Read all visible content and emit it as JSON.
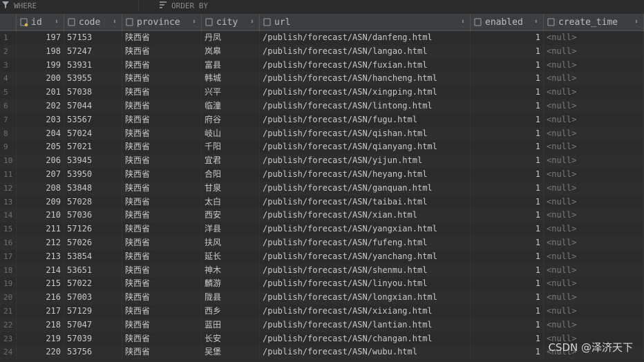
{
  "filter": {
    "where_label": "WHERE",
    "orderby_label": "ORDER BY"
  },
  "columns": [
    {
      "key": "id",
      "label": "id"
    },
    {
      "key": "code",
      "label": "code"
    },
    {
      "key": "province",
      "label": "province"
    },
    {
      "key": "city",
      "label": "city"
    },
    {
      "key": "url",
      "label": "url"
    },
    {
      "key": "enabled",
      "label": "enabled"
    },
    {
      "key": "create_time",
      "label": "create_time"
    }
  ],
  "rows": [
    [
      "1",
      "197",
      "57153",
      "陕西省",
      "丹凤",
      "/publish/forecast/ASN/danfeng.html",
      "1",
      "<null>"
    ],
    [
      "2",
      "198",
      "57247",
      "陕西省",
      "岚皋",
      "/publish/forecast/ASN/langao.html",
      "1",
      "<null>"
    ],
    [
      "3",
      "199",
      "53931",
      "陕西省",
      "富县",
      "/publish/forecast/ASN/fuxian.html",
      "1",
      "<null>"
    ],
    [
      "4",
      "200",
      "53955",
      "陕西省",
      "韩城",
      "/publish/forecast/ASN/hancheng.html",
      "1",
      "<null>"
    ],
    [
      "5",
      "201",
      "57038",
      "陕西省",
      "兴平",
      "/publish/forecast/ASN/xingping.html",
      "1",
      "<null>"
    ],
    [
      "6",
      "202",
      "57044",
      "陕西省",
      "临潼",
      "/publish/forecast/ASN/lintong.html",
      "1",
      "<null>"
    ],
    [
      "7",
      "203",
      "53567",
      "陕西省",
      "府谷",
      "/publish/forecast/ASN/fugu.html",
      "1",
      "<null>"
    ],
    [
      "8",
      "204",
      "57024",
      "陕西省",
      "岐山",
      "/publish/forecast/ASN/qishan.html",
      "1",
      "<null>"
    ],
    [
      "9",
      "205",
      "57021",
      "陕西省",
      "千阳",
      "/publish/forecast/ASN/qianyang.html",
      "1",
      "<null>"
    ],
    [
      "10",
      "206",
      "53945",
      "陕西省",
      "宜君",
      "/publish/forecast/ASN/yijun.html",
      "1",
      "<null>"
    ],
    [
      "11",
      "207",
      "53950",
      "陕西省",
      "合阳",
      "/publish/forecast/ASN/heyang.html",
      "1",
      "<null>"
    ],
    [
      "12",
      "208",
      "53848",
      "陕西省",
      "甘泉",
      "/publish/forecast/ASN/ganquan.html",
      "1",
      "<null>"
    ],
    [
      "13",
      "209",
      "57028",
      "陕西省",
      "太白",
      "/publish/forecast/ASN/taibai.html",
      "1",
      "<null>"
    ],
    [
      "14",
      "210",
      "57036",
      "陕西省",
      "西安",
      "/publish/forecast/ASN/xian.html",
      "1",
      "<null>"
    ],
    [
      "15",
      "211",
      "57126",
      "陕西省",
      "洋县",
      "/publish/forecast/ASN/yangxian.html",
      "1",
      "<null>"
    ],
    [
      "16",
      "212",
      "57026",
      "陕西省",
      "扶风",
      "/publish/forecast/ASN/fufeng.html",
      "1",
      "<null>"
    ],
    [
      "17",
      "213",
      "53854",
      "陕西省",
      "延长",
      "/publish/forecast/ASN/yanchang.html",
      "1",
      "<null>"
    ],
    [
      "18",
      "214",
      "53651",
      "陕西省",
      "神木",
      "/publish/forecast/ASN/shenmu.html",
      "1",
      "<null>"
    ],
    [
      "19",
      "215",
      "57022",
      "陕西省",
      "麟游",
      "/publish/forecast/ASN/linyou.html",
      "1",
      "<null>"
    ],
    [
      "20",
      "216",
      "57003",
      "陕西省",
      "陇县",
      "/publish/forecast/ASN/longxian.html",
      "1",
      "<null>"
    ],
    [
      "21",
      "217",
      "57129",
      "陕西省",
      "西乡",
      "/publish/forecast/ASN/xixiang.html",
      "1",
      "<null>"
    ],
    [
      "22",
      "218",
      "57047",
      "陕西省",
      "蓝田",
      "/publish/forecast/ASN/lantian.html",
      "1",
      "<null>"
    ],
    [
      "23",
      "219",
      "57039",
      "陕西省",
      "长安",
      "/publish/forecast/ASN/changan.html",
      "1",
      "<null>"
    ],
    [
      "24",
      "220",
      "53756",
      "陕西省",
      "吴堡",
      "/publish/forecast/ASN/wubu.html",
      "1",
      "<null>"
    ]
  ],
  "watermark": "CSDN @泽济天下"
}
